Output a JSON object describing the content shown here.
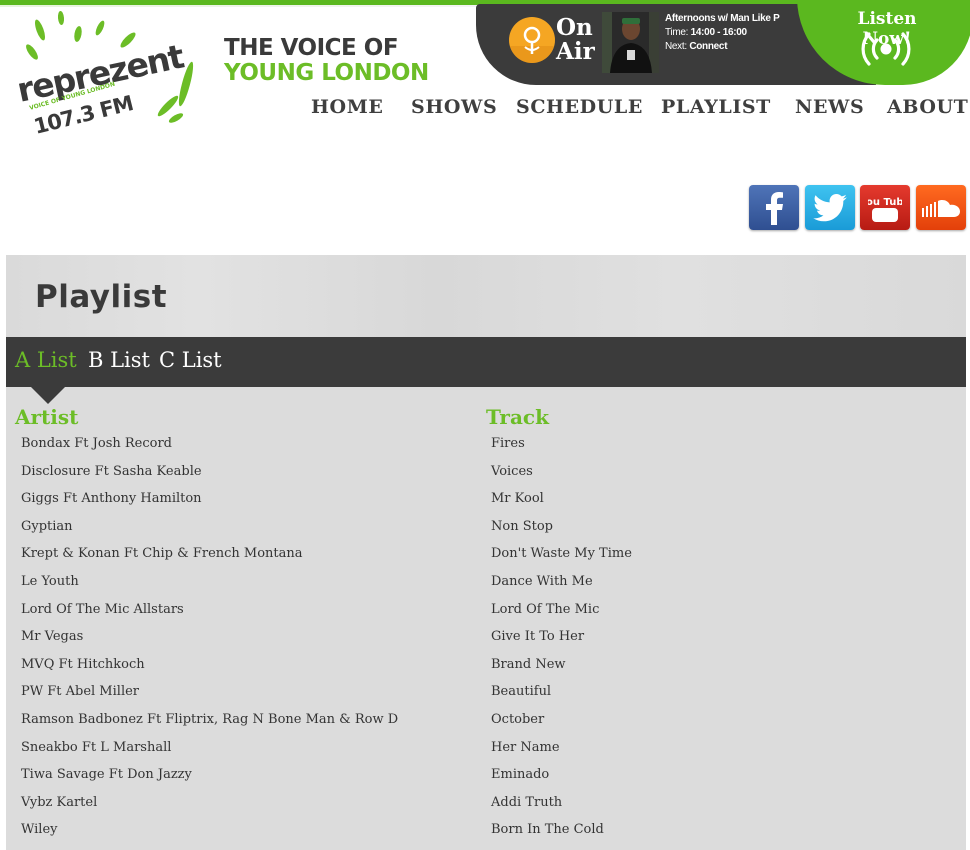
{
  "logo": {
    "text": "reprezent",
    "small_text": "VOICE OF YOUNG LONDON",
    "frequency": "107.3 FM"
  },
  "tagline": {
    "line1": "THE VOICE OF",
    "line2": "YOUNG LONDON"
  },
  "on_air": {
    "label_line1": "On",
    "label_line2": "Air",
    "show_title": "Afternoons w/ Man Like P",
    "time_label": "Time:",
    "time_value": "14:00 - 16:00",
    "next_label": "Next:",
    "next_value": "Connect"
  },
  "listen": {
    "label": "Listen Now!"
  },
  "nav": {
    "items": [
      "HOME",
      "SHOWS",
      "SCHEDULE",
      "PLAYLIST",
      "NEWS",
      "ABOUT"
    ]
  },
  "social": {
    "icons": [
      "facebook-icon",
      "twitter-icon",
      "youtube-icon",
      "soundcloud-icon"
    ],
    "youtube_text": "You Tube"
  },
  "playlist": {
    "title": "Playlist",
    "tabs": [
      "A List",
      "B List",
      "C List"
    ],
    "active_tab": "A List",
    "artist_header": "Artist",
    "track_header": "Track",
    "rows": [
      {
        "artist": "Bondax Ft Josh Record",
        "track": "Fires"
      },
      {
        "artist": "Disclosure Ft Sasha Keable",
        "track": "Voices"
      },
      {
        "artist": "Giggs Ft Anthony Hamilton",
        "track": "Mr Kool"
      },
      {
        "artist": "Gyptian",
        "track": "Non Stop"
      },
      {
        "artist": "Krept & Konan Ft Chip & French Montana",
        "track": "Don't Waste My Time"
      },
      {
        "artist": "Le Youth",
        "track": "Dance With Me"
      },
      {
        "artist": "Lord Of The Mic Allstars",
        "track": "Lord Of The Mic"
      },
      {
        "artist": "Mr Vegas",
        "track": "Give It To Her"
      },
      {
        "artist": "MVQ Ft Hitchkoch",
        "track": "Brand New"
      },
      {
        "artist": "PW Ft Abel Miller",
        "track": "Beautiful"
      },
      {
        "artist": "Ramson Badbonez Ft Fliptrix, Rag N Bone Man & Row D",
        "track": "October"
      },
      {
        "artist": "Sneakbo Ft L Marshall",
        "track": "Her Name"
      },
      {
        "artist": "Tiwa Savage Ft Don Jazzy",
        "track": "Eminado"
      },
      {
        "artist": "Vybz Kartel",
        "track": "Addi Truth"
      },
      {
        "artist": "Wiley",
        "track": "Born In The Cold"
      }
    ]
  },
  "colors": {
    "brand_green": "#6cbd27",
    "dark": "#3b3b3b",
    "panel_bg": "#dcdcdc"
  }
}
